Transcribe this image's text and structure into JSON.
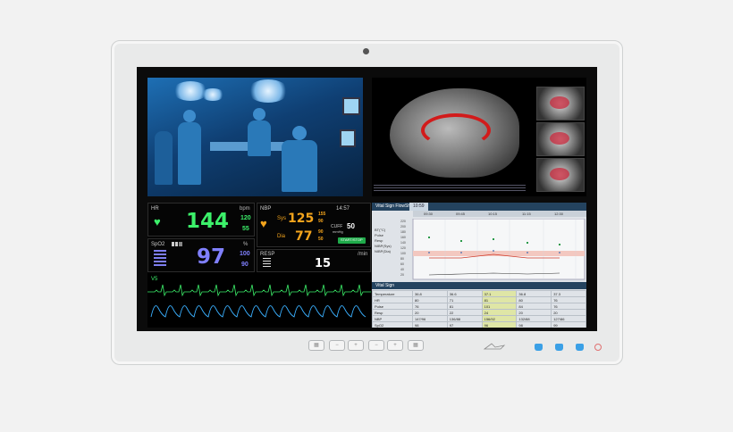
{
  "vitals": {
    "hr": {
      "label": "HR",
      "unit": "bpm",
      "value": "144",
      "upper": "120",
      "lower": "55"
    },
    "nbp": {
      "label": "NBP",
      "time": "14:57",
      "sys_label": "Sys",
      "sys": "125",
      "sys_upper": "155",
      "sys_lower": "90",
      "dia_label": "Dia",
      "dia": "77",
      "dia_upper": "90",
      "dia_lower": "50",
      "cuff_label": "CUFF",
      "cuff": "50",
      "cuff_unit": "mmHg",
      "button": "START/STOP"
    },
    "spo2": {
      "label": "SpO2",
      "unit": "%",
      "value": "97",
      "upper": "100",
      "lower": "90"
    },
    "resp": {
      "label": "RESP",
      "unit": "/min",
      "value": "15"
    },
    "ecg": {
      "label": "V5"
    }
  },
  "flowsheet": {
    "title": "Vital Sign FlowSheet",
    "tab": "10:59",
    "times": [
      "09:30",
      "09:45",
      "10:15",
      "11:15",
      "12:30"
    ],
    "legend": [
      "BT(°C)",
      "Pulse",
      "Resp",
      "NIBP(Sys)",
      "NIBP(Dia)"
    ],
    "y_ticks": [
      "220",
      "200",
      "180",
      "160",
      "140",
      "120",
      "100",
      "80",
      "60",
      "40",
      "20"
    ],
    "table_title": "Vital Sign",
    "rows": [
      [
        "Temperature",
        "36.8",
        "36.6",
        "37.1",
        "36.8",
        "37.3"
      ],
      [
        "HR",
        "80",
        "71",
        "81",
        "80",
        "76"
      ],
      [
        "Pulse",
        "76",
        "81",
        "101",
        "84",
        "76"
      ],
      [
        "Resp",
        "20",
        "22",
        "24",
        "20",
        "20"
      ],
      [
        "NBP",
        "147/96",
        "136/88",
        "156/92",
        "132/88",
        "127/86"
      ],
      [
        "SpO2",
        "98",
        "97",
        "96",
        "98",
        "99"
      ]
    ]
  },
  "colors": {
    "hr": "#3cf06a",
    "nbp": "#f4a41c",
    "spo2": "#8080ff",
    "resp": "#ffffff",
    "ecg": "#3cf06a",
    "pleth": "#3ab0ff"
  }
}
